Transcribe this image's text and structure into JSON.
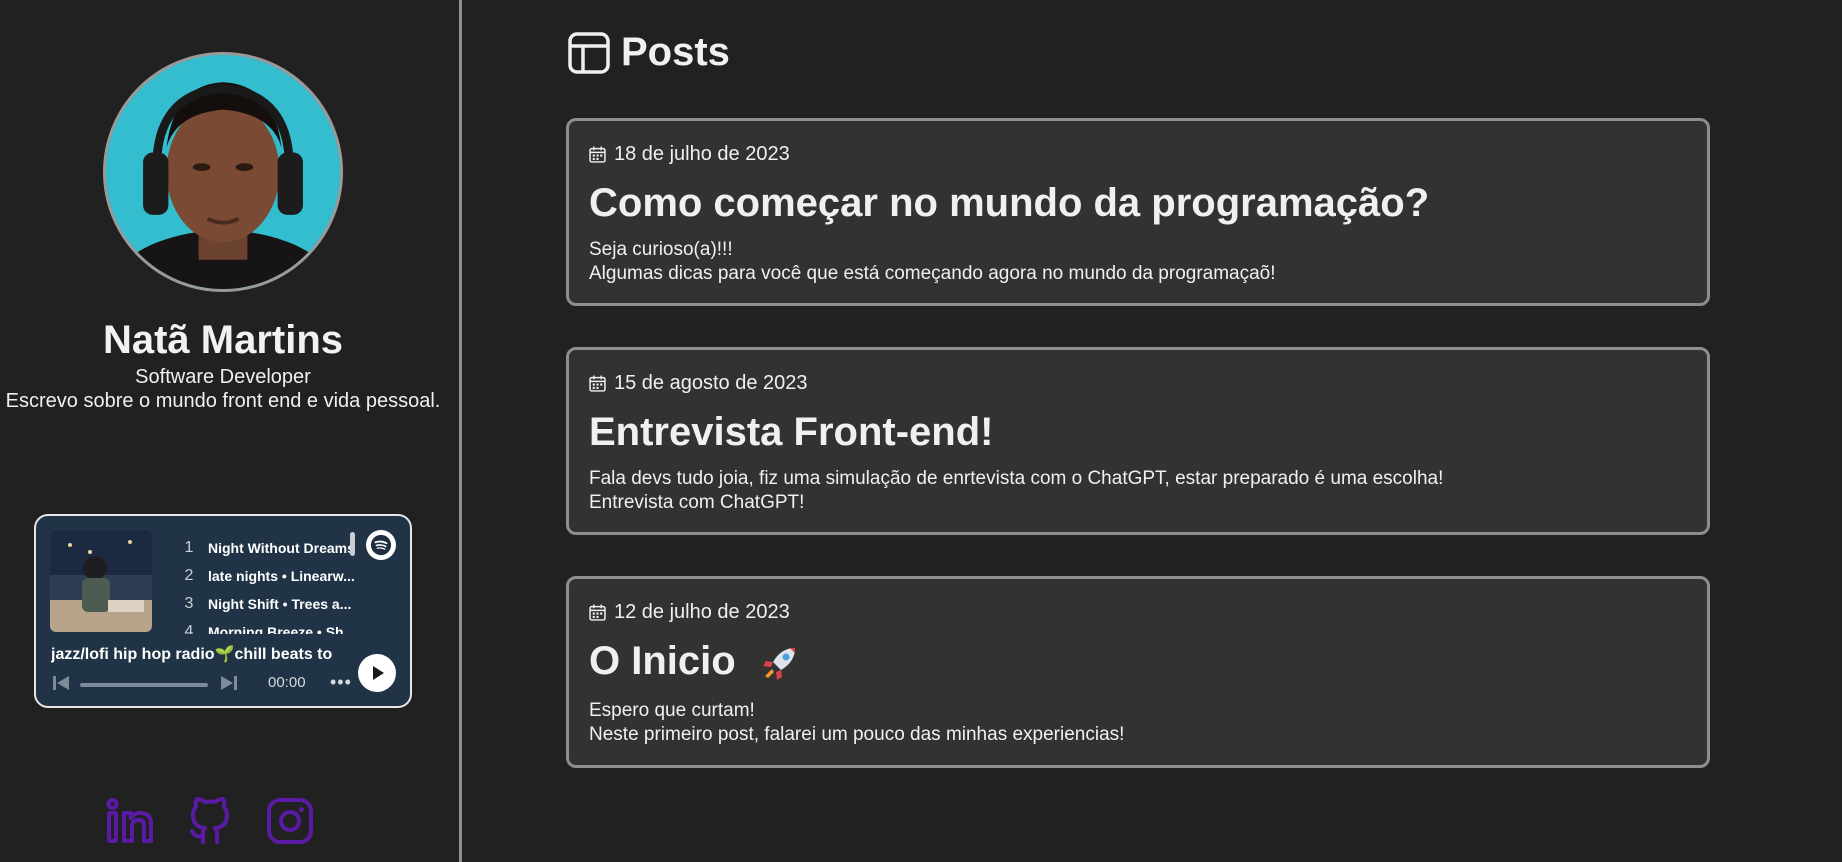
{
  "profile": {
    "name": "Natã Martins",
    "role": "Software Developer",
    "bio": "Escrevo sobre o mundo front end e vida pessoal."
  },
  "player": {
    "tracks": [
      {
        "num": "1",
        "title": "Night Without Dreams"
      },
      {
        "num": "2",
        "title": "late nights • Linearw..."
      },
      {
        "num": "3",
        "title": "Night Shift • Trees a..."
      },
      {
        "num": "4",
        "title": "Morning Breeze • Sh..."
      }
    ],
    "playlist_title": "jazz/lofi hip hop radio🌱chill beats to",
    "time": "00:00",
    "progress": 0,
    "more_label": "•••"
  },
  "socials": [
    "linkedin-icon",
    "github-icon",
    "instagram-icon"
  ],
  "main": {
    "title": "Posts",
    "posts": [
      {
        "date": "18 de julho de 2023",
        "title": "Como começar no mundo da programação?",
        "lines": [
          "Seja curioso(a)!!!",
          "Algumas dicas para você que está começando agora no mundo da programaçaõ!"
        ]
      },
      {
        "date": "15 de agosto de 2023",
        "title": "Entrevista Front-end!",
        "lines": [
          "Fala devs tudo joia, fiz uma simulação de enrtevista com o ChatGPT, estar preparado é uma escolha!",
          "Entrevista com ChatGPT!"
        ]
      },
      {
        "date": "12 de julho de 2023",
        "title": "O Inicio",
        "lines": [
          "Espero que curtam!",
          "Neste primeiro post, falarei um pouco das minhas experiencias!"
        ]
      }
    ]
  },
  "colors": {
    "background": "#212121",
    "card": "#323232",
    "card_border": "#8e8e8e",
    "player_bg": "#213447",
    "social_purple": "#5b1aa6"
  }
}
